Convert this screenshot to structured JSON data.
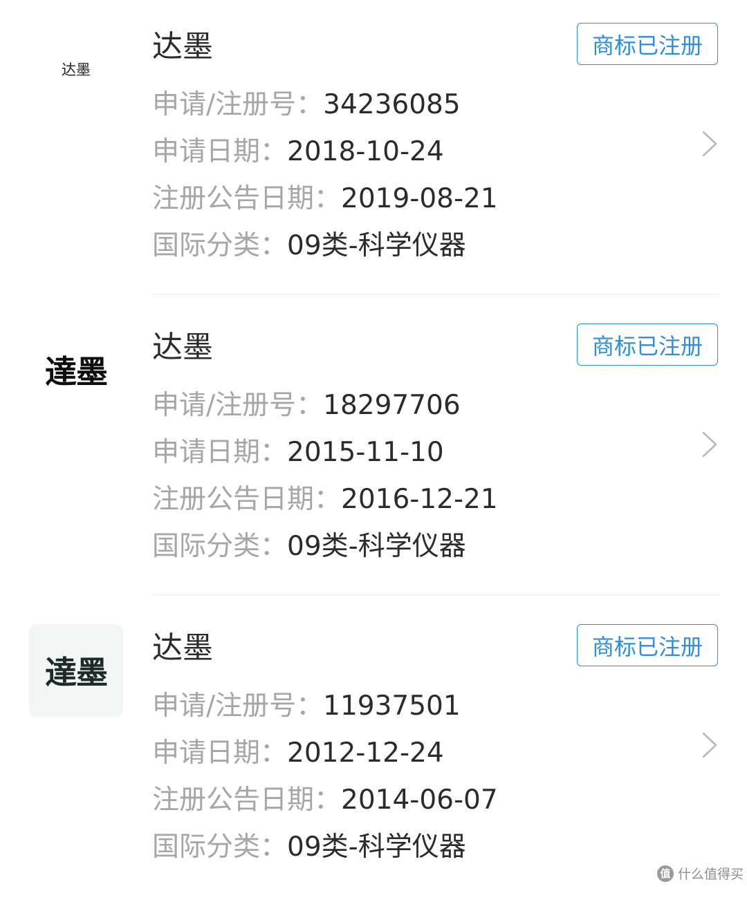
{
  "trademarks": [
    {
      "logo_text": "达墨",
      "name": "达墨",
      "status": "商标已注册",
      "reg_label": "申请/注册号：",
      "reg_no": "34236085",
      "apply_label": "申请日期：",
      "apply_date": "2018-10-24",
      "pub_label": "注册公告日期：",
      "pub_date": "2019-08-21",
      "class_label": "国际分类：",
      "class": "09类-科学仪器"
    },
    {
      "logo_text": "達墨",
      "name": "达墨",
      "status": "商标已注册",
      "reg_label": "申请/注册号：",
      "reg_no": "18297706",
      "apply_label": "申请日期：",
      "apply_date": "2015-11-10",
      "pub_label": "注册公告日期：",
      "pub_date": "2016-12-21",
      "class_label": "国际分类：",
      "class": "09类-科学仪器"
    },
    {
      "logo_text": "達墨",
      "name": "达墨",
      "status": "商标已注册",
      "reg_label": "申请/注册号：",
      "reg_no": "11937501",
      "apply_label": "申请日期：",
      "apply_date": "2012-12-24",
      "pub_label": "注册公告日期：",
      "pub_date": "2014-06-07",
      "class_label": "国际分类：",
      "class": "09类-科学仪器"
    }
  ],
  "watermark": {
    "icon_text": "值",
    "text": "什么值得买"
  },
  "colors": {
    "accent": "#2f8fd6",
    "label": "#a6a6a6",
    "value": "#2b2b2b",
    "divider": "#ebebeb"
  },
  "icons": {
    "row_action": "chevron-right-icon"
  }
}
